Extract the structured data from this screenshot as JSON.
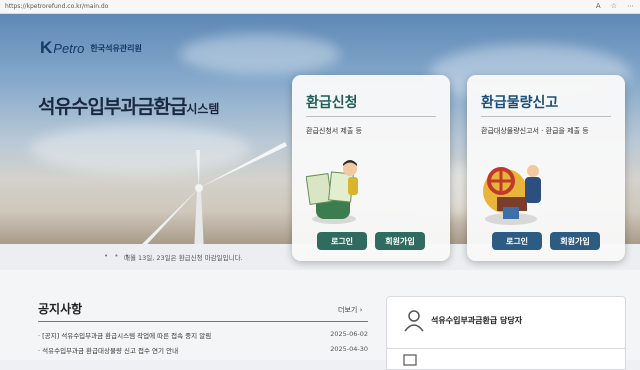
{
  "browser": {
    "url": "https://kpetrorefund.co.kr/main.do",
    "icons": [
      "A",
      "☆",
      "⋯"
    ]
  },
  "header": {
    "logo_k": "K",
    "logo_petro": "Petro",
    "logo_org": "한국석유관리원",
    "title_main": "석유수입부과금환급",
    "title_suffix": "시스템"
  },
  "notice_banner": {
    "dots": "• • •",
    "text": "매월 13일, 23일은 환급신청 마감일입니다."
  },
  "cards": [
    {
      "title": "환급신청",
      "desc": "환급신청서 제출 등",
      "login": "로그인",
      "signup": "회원가입"
    },
    {
      "title": "환급물량신고",
      "desc": "환급대상물량신고서 · 환급을 제출 등",
      "login": "로그인",
      "signup": "회원가입"
    }
  ],
  "notices": {
    "title": "공지사항",
    "more": "더보기",
    "items": [
      {
        "text": "· [공지] 석유수입부과금 환급시스템 작업에 따른 접속 중지 알림",
        "date": "2025-06-02"
      },
      {
        "text": "· 석유수입부과금 환급대상물량 신고 접수 연기 안내",
        "date": "2025-04-30"
      }
    ]
  },
  "contact": {
    "label": "석유수입부과금환급 담당자"
  }
}
